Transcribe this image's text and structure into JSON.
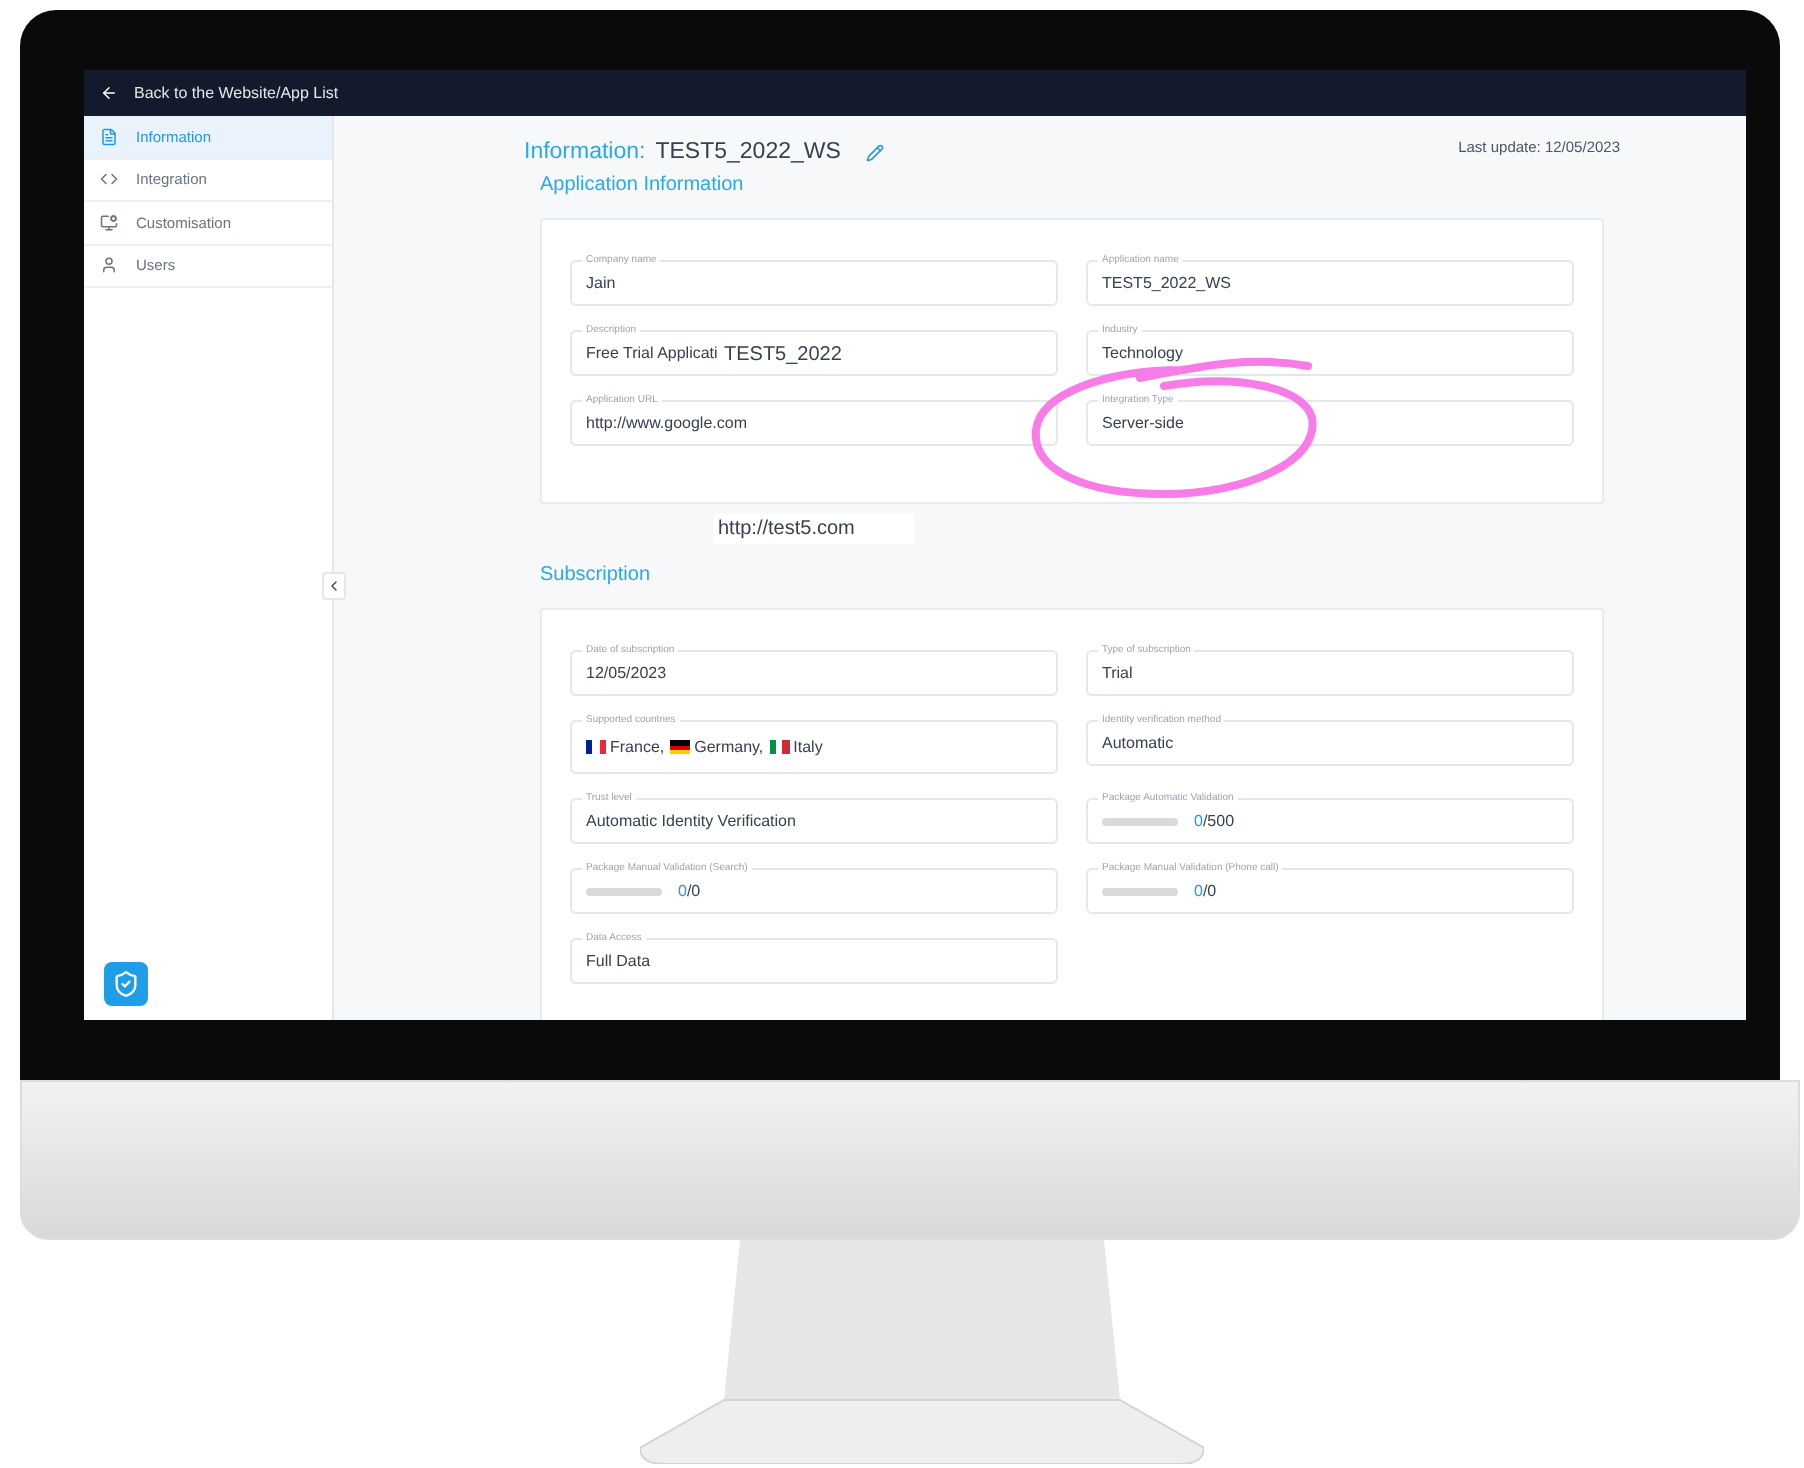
{
  "topbar": {
    "back_label": "Back to the Website/App List"
  },
  "sidebar": {
    "items": [
      {
        "label": "Information",
        "selected": true
      },
      {
        "label": "Integration",
        "selected": false
      },
      {
        "label": "Customisation",
        "selected": false
      },
      {
        "label": "Users",
        "selected": false
      }
    ]
  },
  "header": {
    "title_label": "Information:",
    "title_value": "TEST5_2022_WS",
    "last_update": "Last update: 12/05/2023"
  },
  "sections": [
    {
      "title": "Application Information",
      "note": "http://test5.com",
      "fields": [
        {
          "kind": "text",
          "label": "Company name",
          "value": "Jain"
        },
        {
          "kind": "text",
          "label": "Application name",
          "value": "TEST5_2022_WS"
        },
        {
          "kind": "text",
          "label": "Description",
          "value": "Free Trial Applicati",
          "overlay": "TEST5_2022"
        },
        {
          "kind": "text",
          "label": "Industry",
          "value": "Technology"
        },
        {
          "kind": "text",
          "label": "Application URL",
          "value": "http://www.google.com"
        },
        {
          "kind": "text",
          "label": "Integration Type",
          "value": "Server-side",
          "circled": true
        }
      ]
    },
    {
      "title": "Subscription",
      "fields": [
        {
          "kind": "text",
          "label": "Date of subscription",
          "value": "12/05/2023"
        },
        {
          "kind": "text",
          "label": "Type of subscription",
          "value": "Trial"
        },
        {
          "kind": "countries",
          "label": "Supported countries",
          "countries": [
            {
              "name": "France,"
            },
            {
              "name": "Germany,"
            },
            {
              "name": "Italy"
            }
          ]
        },
        {
          "kind": "text",
          "label": "Identity verification method",
          "value": "Automatic"
        },
        {
          "kind": "text",
          "label": "Trust level",
          "value": "Automatic Identity Verification"
        },
        {
          "kind": "quota",
          "label": "Package Automatic Validation",
          "level": 0,
          "used": "0",
          "total": "/500"
        },
        {
          "kind": "quota",
          "label": "Package Manual Validation (Search)",
          "level": 0,
          "used": "0",
          "total": "/0"
        },
        {
          "kind": "quota",
          "label": "Package Manual Validation (Phone call)",
          "level": 0,
          "used": "0",
          "total": "/0"
        },
        {
          "kind": "text",
          "label": "Data Access",
          "value": "Full Data"
        }
      ]
    }
  ]
}
